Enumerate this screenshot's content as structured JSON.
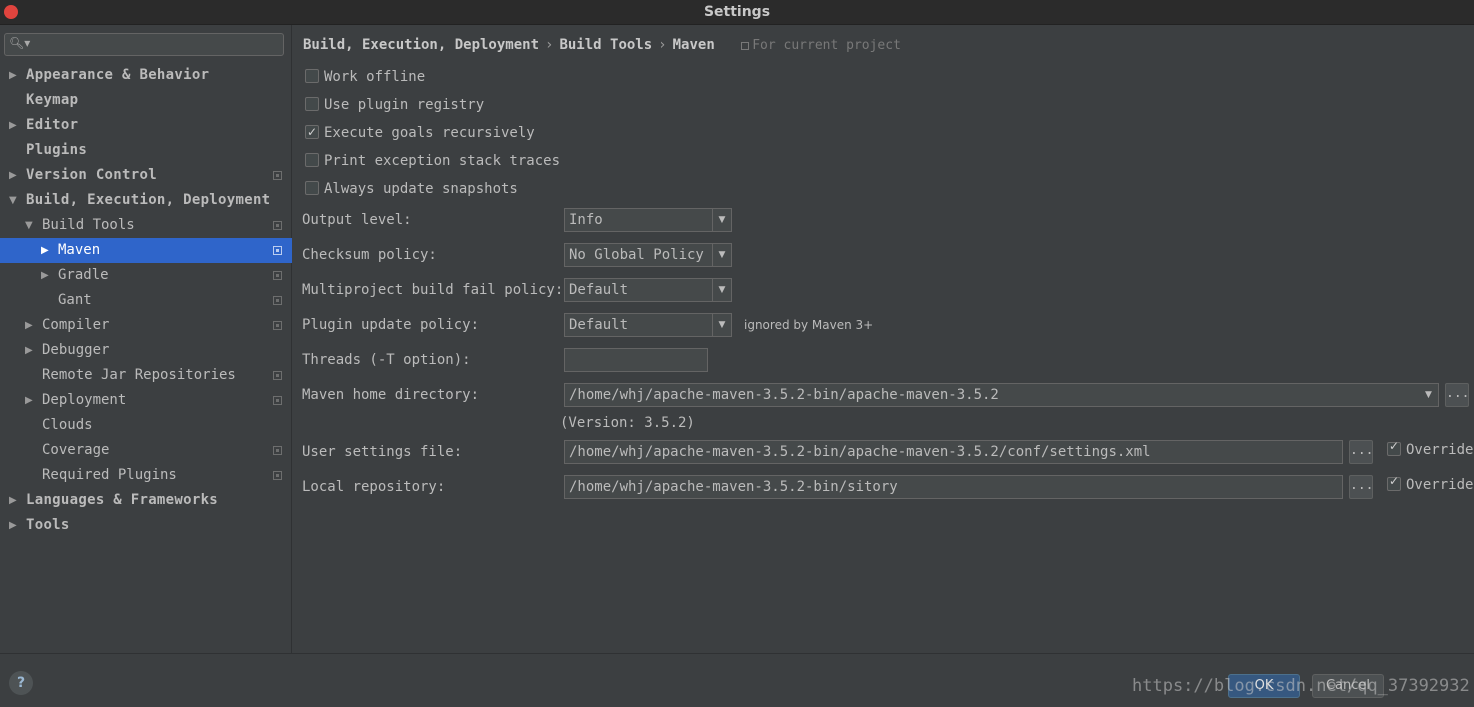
{
  "window": {
    "title": "Settings"
  },
  "sidebar": {
    "search_placeholder": "",
    "items": [
      {
        "label": "Appearance & Behavior",
        "arrow": "▶"
      },
      {
        "label": "Keymap",
        "arrow": ""
      },
      {
        "label": "Editor",
        "arrow": "▶"
      },
      {
        "label": "Plugins",
        "arrow": ""
      },
      {
        "label": "Version Control",
        "arrow": "▶"
      },
      {
        "label": "Build, Execution, Deployment",
        "arrow": "▼"
      },
      {
        "label": "Build Tools",
        "arrow": "▼"
      },
      {
        "label": "Maven",
        "arrow": "▶"
      },
      {
        "label": "Gradle",
        "arrow": "▶"
      },
      {
        "label": "Gant",
        "arrow": ""
      },
      {
        "label": "Compiler",
        "arrow": "▶"
      },
      {
        "label": "Debugger",
        "arrow": "▶"
      },
      {
        "label": "Remote Jar Repositories",
        "arrow": ""
      },
      {
        "label": "Deployment",
        "arrow": "▶"
      },
      {
        "label": "Clouds",
        "arrow": ""
      },
      {
        "label": "Coverage",
        "arrow": ""
      },
      {
        "label": "Required Plugins",
        "arrow": ""
      },
      {
        "label": "Languages & Frameworks",
        "arrow": "▶"
      },
      {
        "label": "Tools",
        "arrow": "▶"
      }
    ]
  },
  "breadcrumb": {
    "part1": "Build, Execution, Deployment",
    "sep": "›",
    "part2": "Build Tools",
    "part3": "Maven",
    "project": "For current project"
  },
  "options": {
    "work_offline": "Work offline",
    "use_plugin_registry": "Use plugin registry",
    "execute_goals_recursively": "Execute goals recursively",
    "print_exception_stack_traces": "Print exception stack traces",
    "always_update_snapshots": "Always update snapshots"
  },
  "form": {
    "output_level_label": "Output level:",
    "output_level_value": "Info",
    "checksum_policy_label": "Checksum policy:",
    "checksum_policy_value": "No Global Policy",
    "multiproject_label": "Multiproject build fail policy:",
    "multiproject_value": "Default",
    "plugin_update_label": "Plugin update policy:",
    "plugin_update_value": "Default",
    "plugin_update_note": "ignored by Maven 3+",
    "threads_label": "Threads (-T option):",
    "threads_value": "",
    "maven_home_label": "Maven home directory:",
    "maven_home_value": "/home/whj/apache-maven-3.5.2-bin/apache-maven-3.5.2",
    "version_text": "(Version: 3.5.2)",
    "user_settings_label": "User settings file:",
    "user_settings_value": "/home/whj/apache-maven-3.5.2-bin/apache-maven-3.5.2/conf/settings.xml",
    "local_repo_label": "Local repository:",
    "local_repo_value": "/home/whj/apache-maven-3.5.2-bin/sitory",
    "override_label": "Override",
    "browse_label": "..."
  },
  "footer": {
    "help": "?",
    "ok": "OK",
    "cancel": "Cancel",
    "watermark": "https://blog.csdn.net/qq_37392932"
  },
  "colors": {
    "background": "#3c3f41",
    "selection": "#2f65ca",
    "ok_button": "#365880",
    "close_button": "#e0443e"
  }
}
